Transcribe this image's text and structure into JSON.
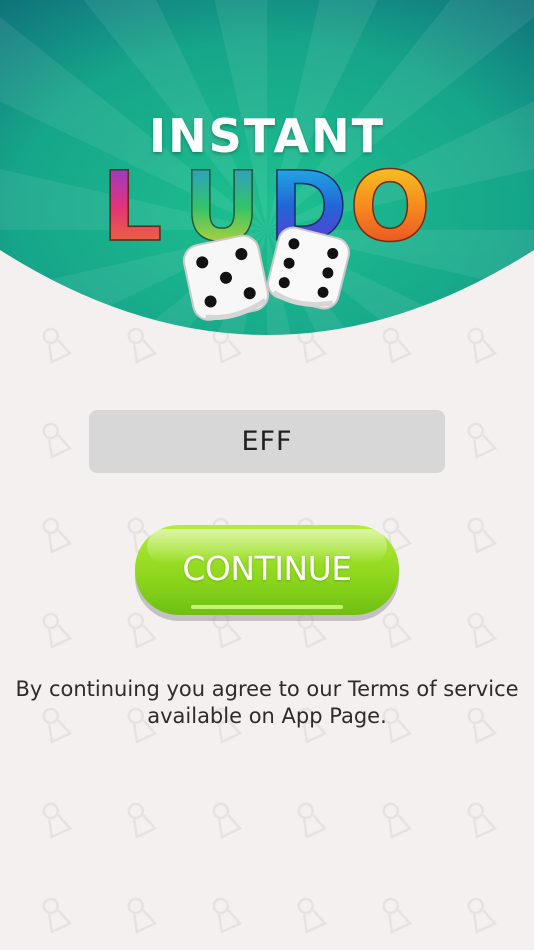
{
  "logo": {
    "line1": "INSTANT",
    "line2_letters": [
      "L",
      "U",
      "D",
      "O"
    ]
  },
  "name_field": {
    "value": "EFF",
    "placeholder": ""
  },
  "continue_button": {
    "label": "CONTINUE"
  },
  "terms_text": "By continuing you agree to our Terms of service available on App Page.",
  "colors": {
    "header_teal": "#16a58a",
    "header_dark": "#0f6f7a",
    "header_green": "#1cc08e",
    "background": "#f3f0ef",
    "field_bg": "#d8d7d7",
    "button_green": "#8ed61c",
    "pattern": "#e7e2e1"
  },
  "icons": [
    "ludo-pawn-icon",
    "dice-icon"
  ]
}
